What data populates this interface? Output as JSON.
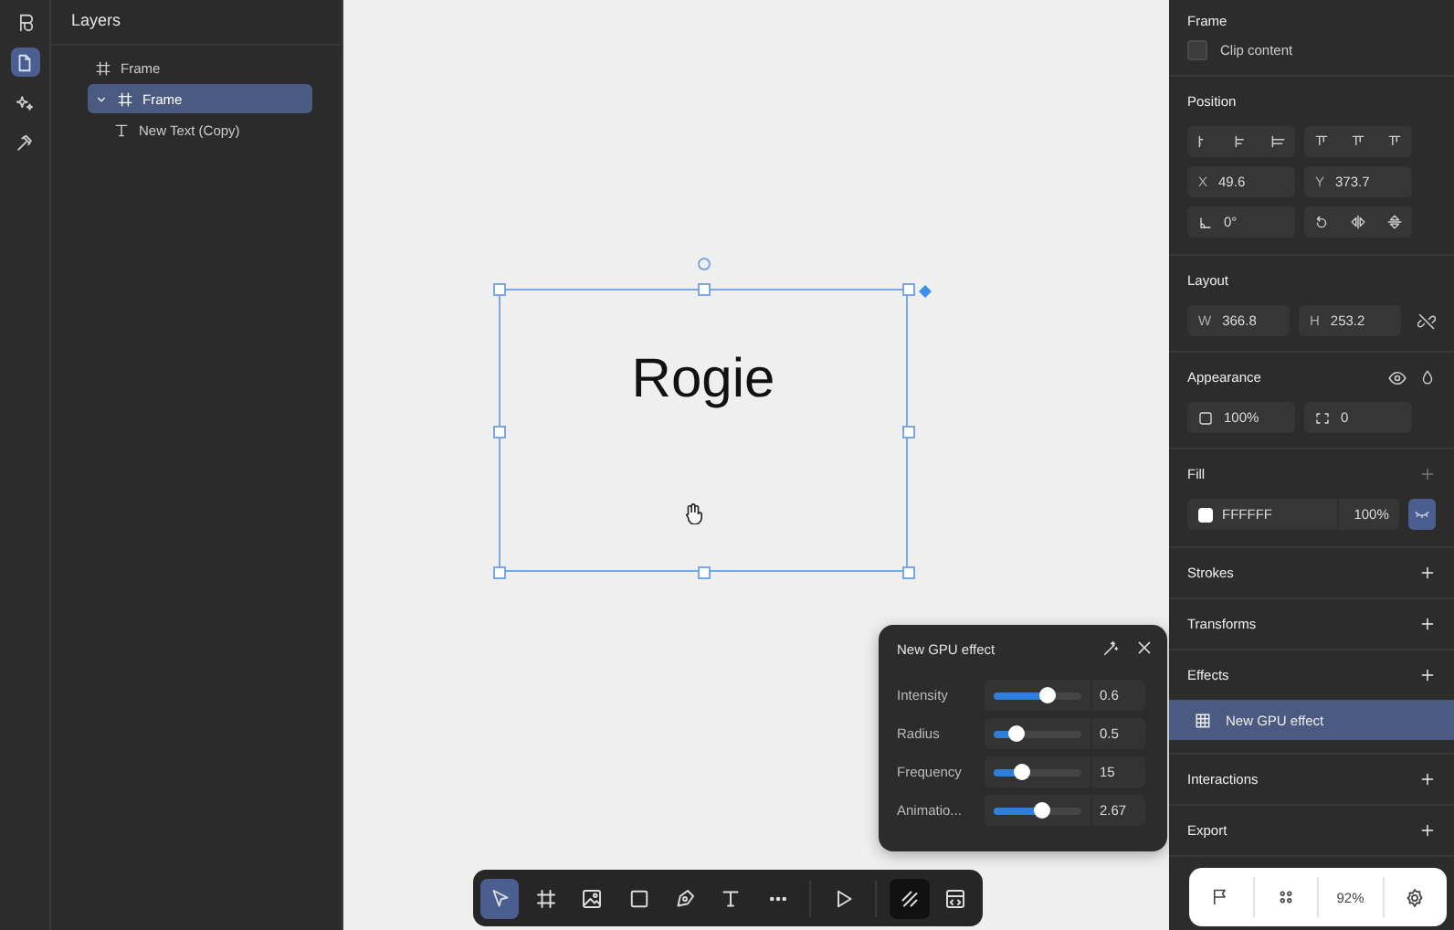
{
  "rail": [
    {
      "kind": "logo",
      "selected": false
    },
    {
      "kind": "pages",
      "selected": true
    },
    {
      "kind": "effects",
      "selected": false
    },
    {
      "kind": "tools",
      "selected": false
    }
  ],
  "layers": {
    "title": "Layers",
    "items": [
      {
        "label": "Frame",
        "kind": "frame",
        "selected": false
      },
      {
        "label": "Frame",
        "kind": "frame",
        "selected": true,
        "expanded": true,
        "children": [
          {
            "label": "New Text (Copy)",
            "kind": "text",
            "selected": false
          }
        ]
      }
    ]
  },
  "canvas": {
    "text": "Rogie"
  },
  "effect_popup": {
    "title": "New GPU effect",
    "sliders": [
      {
        "label": "Intensity",
        "level": 0.6,
        "reading": "0.6"
      },
      {
        "label": "Radius",
        "level": 0.26,
        "reading": "0.5"
      },
      {
        "label": "Frequency",
        "level": 0.32,
        "reading": "15"
      },
      {
        "label": "Animatio...",
        "level": 0.54,
        "reading": "2.67"
      }
    ]
  },
  "toolbar": [
    {
      "kind": "select",
      "selected": true
    },
    {
      "kind": "frame",
      "selected": false
    },
    {
      "kind": "image",
      "selected": false
    },
    {
      "kind": "rectangle",
      "selected": false
    },
    {
      "kind": "pen",
      "selected": false
    },
    {
      "kind": "text",
      "selected": false
    },
    {
      "kind": "more",
      "selected": false
    },
    {
      "kind": "play",
      "selected": false
    },
    {
      "kind": "draw",
      "selected": true
    },
    {
      "kind": "dev",
      "selected": false
    }
  ],
  "inspector": {
    "title": "Frame",
    "clip_content": {
      "label": "Clip content",
      "checked": false
    },
    "position": {
      "title": "Position",
      "x": {
        "label": "X",
        "value": "49.6"
      },
      "y": {
        "label": "Y",
        "value": "373.7"
      },
      "rotation": "0°"
    },
    "layout": {
      "title": "Layout",
      "w": {
        "label": "W",
        "value": "366.8"
      },
      "h": {
        "label": "H",
        "value": "253.2"
      }
    },
    "appearance": {
      "title": "Appearance",
      "opacity": "100%",
      "radius": "0"
    },
    "fill": {
      "title": "Fill",
      "hex": "FFFFFF",
      "color": "#ffffff",
      "opacity": "100%"
    },
    "sections": [
      "Strokes",
      "Transforms",
      "Effects"
    ],
    "effects": [
      {
        "label": "New GPU effect",
        "selected": true
      }
    ],
    "more_sections": [
      "Interactions",
      "Export"
    ]
  },
  "zoom_bar": {
    "zoom": "92%"
  }
}
